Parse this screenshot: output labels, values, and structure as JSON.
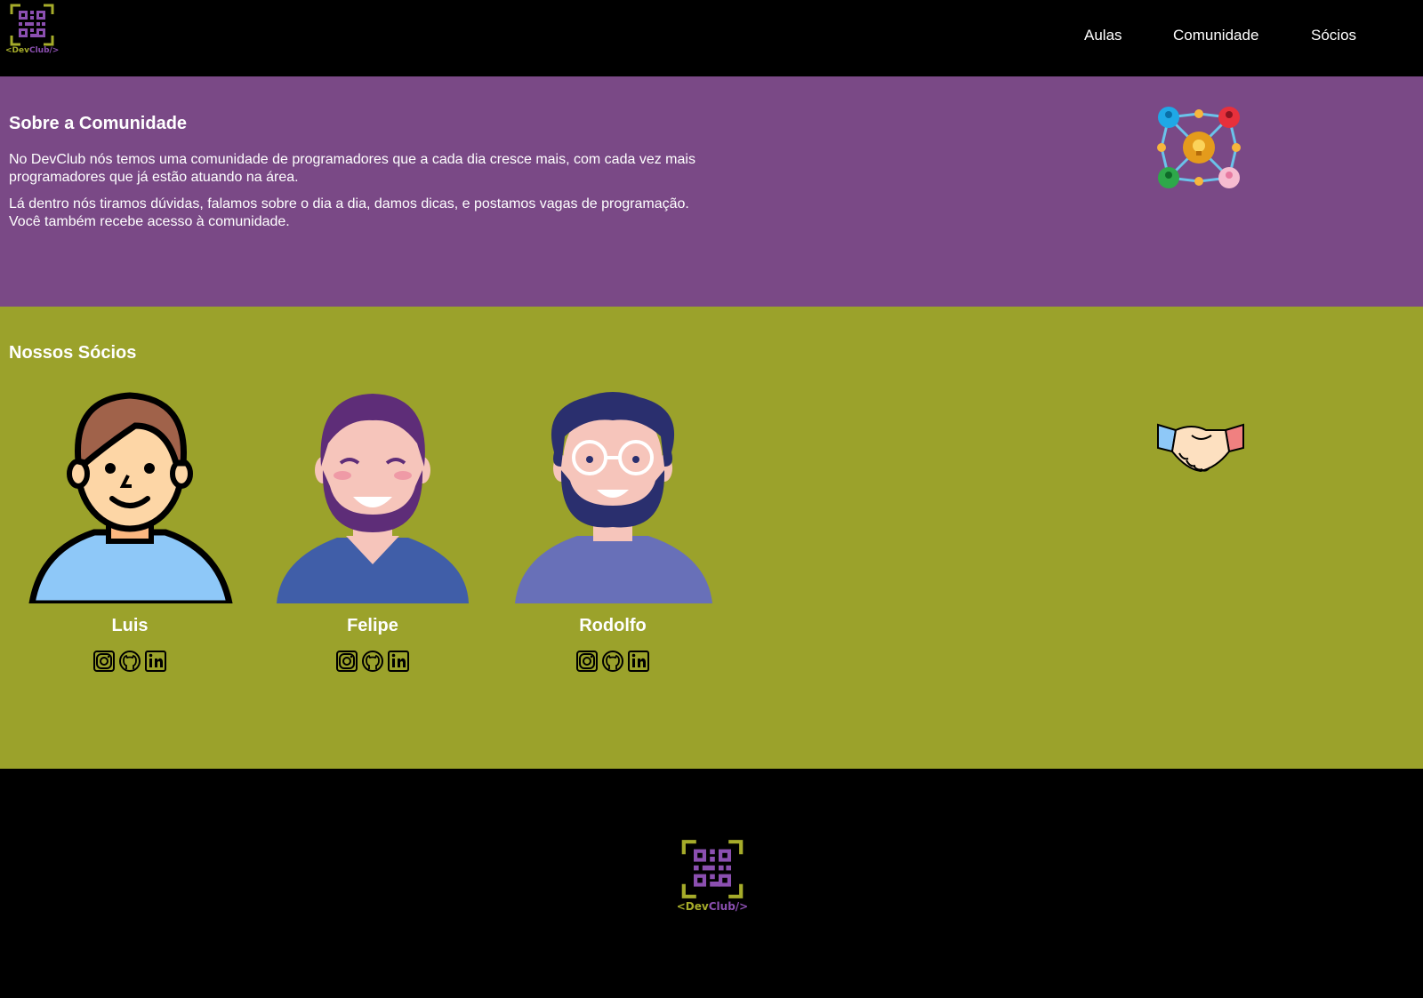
{
  "brand": {
    "logo_text_dev": "<Dev",
    "logo_text_club": "Club/>",
    "colors": {
      "green": "#a6ac2a",
      "purple": "#8b4fb0"
    }
  },
  "nav": {
    "items": [
      {
        "label": "Aulas"
      },
      {
        "label": "Comunidade"
      },
      {
        "label": "Sócios"
      }
    ]
  },
  "about": {
    "title": "Sobre a Comunidade",
    "paragraph_1": "No DevClub nós temos uma comunidade de programadores que a cada dia cresce mais, com cada vez mais programadores que já estão atuando na área.",
    "paragraph_2": "Lá dentro nós tiramos dúvidas, falamos sobre o dia a dia, damos dicas, e postamos vagas de programação. Você também recebe acesso à comunidade.",
    "illustration": "community-network-icon",
    "background": "#7a4986"
  },
  "partners": {
    "title": "Nossos Sócios",
    "background": "#9ba22b",
    "illustration": "handshake-icon",
    "people": [
      {
        "name": "Luis",
        "avatar": "avatar-luis",
        "socials": [
          "instagram-icon",
          "github-icon",
          "linkedin-icon"
        ]
      },
      {
        "name": "Felipe",
        "avatar": "avatar-felipe",
        "socials": [
          "instagram-icon",
          "github-icon",
          "linkedin-icon"
        ]
      },
      {
        "name": "Rodolfo",
        "avatar": "avatar-rodolfo",
        "socials": [
          "instagram-icon",
          "github-icon",
          "linkedin-icon"
        ]
      }
    ]
  },
  "footer": {
    "logo_text_dev": "<Dev",
    "logo_text_club": "Club/>"
  }
}
